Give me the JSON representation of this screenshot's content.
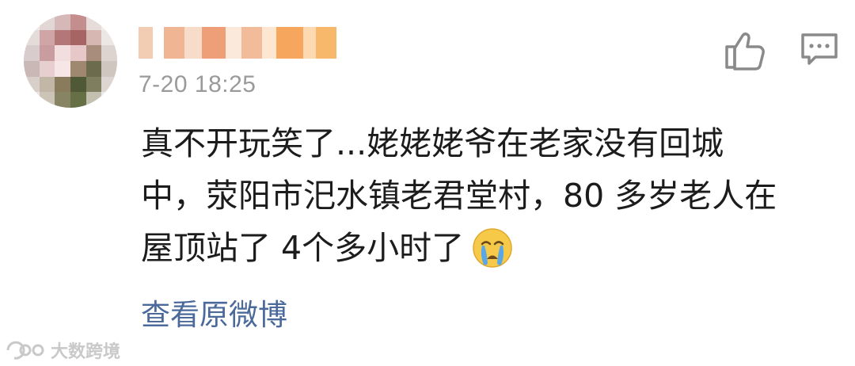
{
  "post": {
    "timestamp": "7-20 18:25",
    "comment_lines": [
      "真不开玩笑了...姥姥姥爷在老家没有回城",
      "中，荥阳市汜水镇老君堂村，80 多岁老人在",
      "屋顶站了 4个多小时了"
    ],
    "emoji": "crying-face-emoji",
    "view_original_label": "查看原微博"
  },
  "actions": {
    "like_icon": "thumbs-up-icon",
    "comment_icon": "comment-icon"
  },
  "watermark": {
    "text": "大数跨境"
  },
  "colors": {
    "text": "#1c1c1c",
    "timestamp": "#9a9a9a",
    "link": "#4b6a9b",
    "watermark": "#c9c9c9"
  }
}
